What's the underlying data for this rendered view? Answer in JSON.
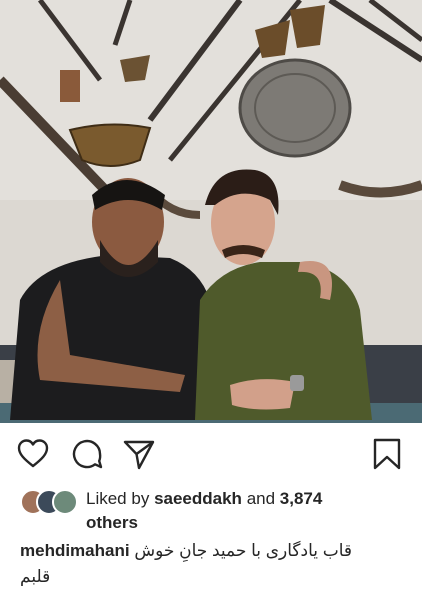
{
  "post": {
    "liked_by_prefix": "Liked by",
    "liked_by_user": "saeeddakh",
    "liked_by_and": "and",
    "likes_count": "3,874",
    "likes_others": "others",
    "caption_user": "mehdimahani",
    "caption_line1": "قاب یادگاری با حمید جانِ خوش",
    "caption_line2": "قلبم"
  },
  "icons": {
    "like": "heart-icon",
    "comment": "comment-icon",
    "share": "send-icon",
    "save": "bookmark-icon"
  },
  "colors": {
    "text": "#262626",
    "icon": "#262626",
    "background": "#ffffff"
  }
}
